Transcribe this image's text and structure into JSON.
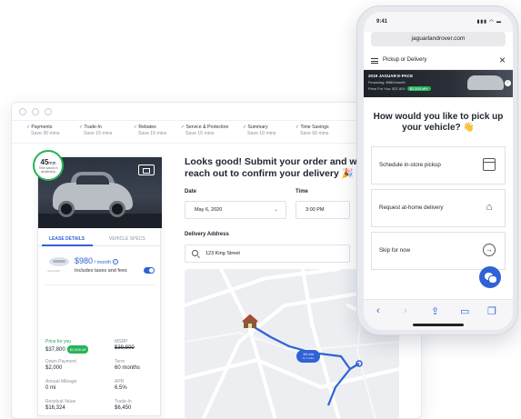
{
  "desktop": {
    "steps": [
      {
        "label": "Payments",
        "sub": "Save 30 mins"
      },
      {
        "label": "Trade-In",
        "sub": "Save 15 mins"
      },
      {
        "label": "Rebates",
        "sub": "Save 15 mins"
      },
      {
        "label": "Service & Protection",
        "sub": "Save 15 mins"
      },
      {
        "label": "Summary",
        "sub": "Save 10 mins"
      },
      {
        "label": "Time Savings",
        "sub": "Save 60 mins"
      }
    ],
    "timer": {
      "value": "45",
      "unit": "min",
      "caption": "Time saved in dealership"
    },
    "tabs": {
      "lease": "LEASE DETAILS",
      "specs": "VEHICLE SPECS"
    },
    "brand_word": "JAGUAR",
    "price": {
      "amount": "$980",
      "per": " / month",
      "taxes": "Includes taxes and fees"
    },
    "specs": {
      "price_for_you": {
        "label": "Price for you",
        "value": "$37,800",
        "badge": "$1,500 off"
      },
      "msrp": {
        "label": "MSRP",
        "value": "$39,800"
      },
      "down": {
        "label": "Down Payment",
        "value": "$2,000"
      },
      "term": {
        "label": "Term",
        "value": "60 months"
      },
      "mileage": {
        "label": "Annual Mileage",
        "value": "0 mi"
      },
      "apr": {
        "label": "APR",
        "value": "6.5%"
      },
      "residual": {
        "label": "Residual Value",
        "value": "$16,324"
      },
      "tradein": {
        "label": "Trade-In",
        "value": "$6,450"
      }
    },
    "headline": "Looks good! Submit your order and we'll reach out to confirm your delivery 🎉",
    "form": {
      "date_label": "Date",
      "date_value": "May 6, 2020",
      "time_label": "Time",
      "time_value": "3:00 PM",
      "address_label": "Delivery Address",
      "address_value": "123 King Street"
    },
    "map": {
      "route_time": "18 min",
      "route_dist": "11.4 miles"
    }
  },
  "phone": {
    "time": "9:41",
    "status_icons": "▮▮▮ ◠ ▬",
    "url": "jaguarlandrover.com",
    "nav_title": "Pickup or Delivery",
    "banner": {
      "title": "2019 JAGUAR E-PACE",
      "financing": "Financing: $980/month",
      "price": "Price For You: $37,800",
      "badge": "$1,500 off+"
    },
    "question": "How would you like to pick up your vehicle? 👋",
    "options": [
      {
        "label": "Schedule in-store pickup",
        "icon": "calendar-icon"
      },
      {
        "label": "Request at-home delivery",
        "icon": "house-icon"
      },
      {
        "label": "Skip for now",
        "icon": "arrow-right-icon"
      }
    ]
  },
  "colors": {
    "accent": "#2f62d6",
    "success": "#27b35a"
  }
}
